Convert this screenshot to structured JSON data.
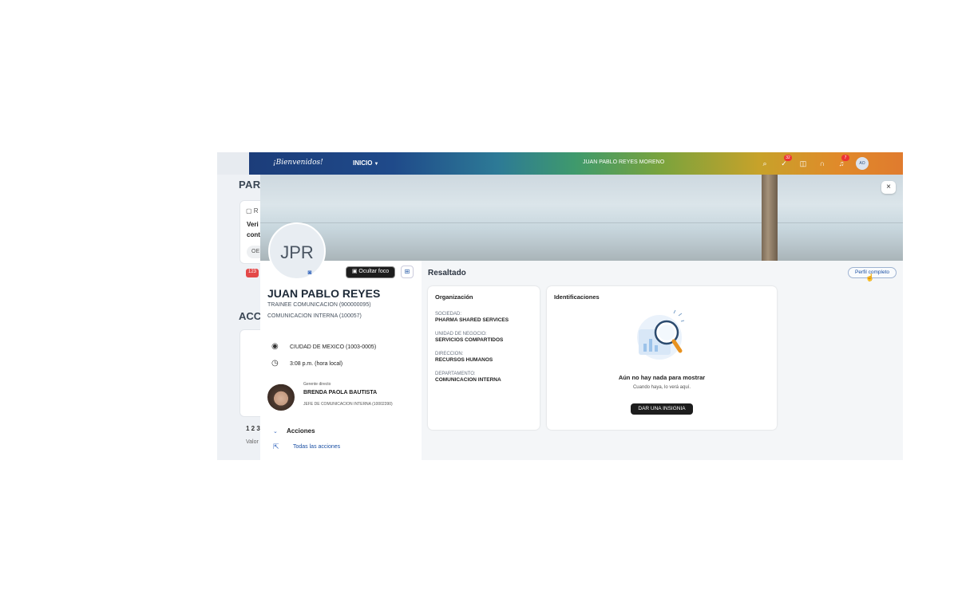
{
  "background_page": {
    "section1_title": "PAR",
    "card": {
      "icon_text": "R",
      "line1": "Veri",
      "line2": "cont",
      "pill": "OE"
    },
    "badge": "123",
    "section2_title": "ACC",
    "pagination": "1 2 3",
    "valor": "Valor"
  },
  "shellbar": {
    "logo": "¡Bienvenidos!",
    "nav_inicio": "INICIO",
    "user_name": "JUAN PABLO REYES MORENO",
    "icons": [
      {
        "name": "search-icon",
        "badge": ""
      },
      {
        "name": "tasks-icon",
        "badge": "32"
      },
      {
        "name": "apps-icon",
        "badge": ""
      },
      {
        "name": "headset-icon",
        "badge": ""
      },
      {
        "name": "notifications-icon",
        "badge": "7"
      }
    ],
    "avatar_initials": "AO"
  },
  "dialog": {
    "close": "×",
    "profile": {
      "initials": "JPR",
      "focus_button": "Ocultar foco",
      "name": "JUAN PABLO REYES",
      "position": "TRAINEE COMUNICACION (900000095)",
      "department": "COMUNICACION INTERNA (100057)",
      "location": "CIUDAD DE MEXICO (1003-0005)",
      "local_time": "3:08 p.m. (hora local)",
      "manager": {
        "caption": "Gerente directo",
        "name": "BRENDA PAOLA BAUTISTA",
        "role": "JEFE DE COMUNICACION INTERNA (10002390)"
      },
      "actions_label": "Acciones",
      "all_actions": "Todas las acciones"
    },
    "highlight": {
      "title": "Resaltado",
      "full_profile_button": "Perfil completo",
      "organization": {
        "title": "Organización",
        "fields": [
          {
            "key": "SOCIEDAD:",
            "value": "PHARMA SHARED SERVICES"
          },
          {
            "key": "UNIDAD DE NEGOCIO:",
            "value": "SERVICIOS COMPARTIDOS"
          },
          {
            "key": "DIRECCION:",
            "value": "RECURSOS HUMANOS"
          },
          {
            "key": "DEPARTAMENTO:",
            "value": "COMUNICACION INTERNA"
          }
        ]
      },
      "badges": {
        "title": "Identificaciones",
        "empty_title": "Aún no hay nada para mostrar",
        "empty_subtitle": "Cuando haya, lo verá aquí.",
        "give_button": "DAR UNA INSIGNIA"
      }
    }
  },
  "colors": {
    "shellbar_start": "#1c3d7a",
    "shellbar_end": "#e07b2e",
    "link": "#1a4fa3",
    "badge_red": "#e33333"
  }
}
